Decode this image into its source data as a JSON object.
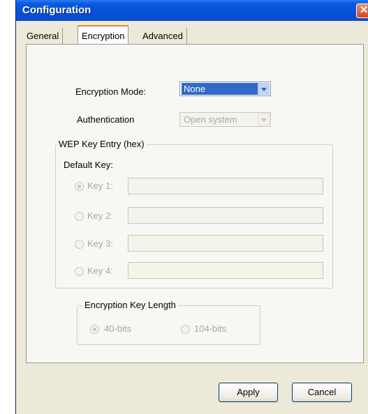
{
  "window": {
    "title": "Configuration"
  },
  "tabs": [
    {
      "label": "General",
      "active": false
    },
    {
      "label": "Encryption",
      "active": true
    },
    {
      "label": "Advanced",
      "active": false
    }
  ],
  "encryption": {
    "mode_label": "Encryption Mode:",
    "mode_value": "None",
    "auth_label": "Authentication",
    "auth_value": "Open system"
  },
  "wep": {
    "title": "WEP Key Entry (hex)",
    "default_key_label": "Default Key:",
    "keys": [
      {
        "label": "Key 1:",
        "value": "",
        "checked": true
      },
      {
        "label": "Key 2:",
        "value": "",
        "checked": false
      },
      {
        "label": "Key 3:",
        "value": "",
        "checked": false
      },
      {
        "label": "Key 4:",
        "value": "",
        "checked": false
      }
    ]
  },
  "key_length": {
    "title": "Encryption Key Length",
    "options": [
      {
        "label": "40-bits",
        "checked": true
      },
      {
        "label": "104-bits",
        "checked": false
      }
    ]
  },
  "buttons": {
    "apply": "Apply",
    "cancel": "Cancel"
  }
}
